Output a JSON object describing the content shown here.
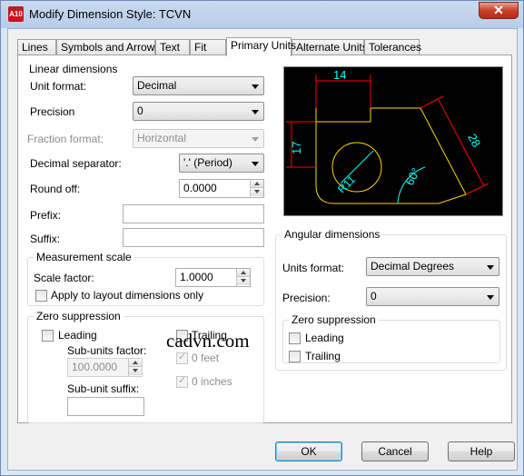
{
  "window": {
    "title": "Modify Dimension Style: TCVN",
    "app_icon_text": "A10",
    "close_symbol": "✕"
  },
  "tabs": [
    {
      "label": "Lines"
    },
    {
      "label": "Symbols and Arrows"
    },
    {
      "label": "Text"
    },
    {
      "label": "Fit"
    },
    {
      "label": "Primary Units",
      "active": true
    },
    {
      "label": "Alternate Units"
    },
    {
      "label": "Tolerances"
    }
  ],
  "linear": {
    "title": "Linear dimensions",
    "unit_format_label": "Unit format:",
    "unit_format_value": "Decimal",
    "precision_label": "Precision",
    "precision_value": "0",
    "fraction_format_label": "Fraction format:",
    "fraction_format_value": "Horizontal",
    "decimal_separator_label": "Decimal separator:",
    "decimal_separator_value": "'.' (Period)",
    "round_off_label": "Round off:",
    "round_off_value": "0.0000",
    "prefix_label": "Prefix:",
    "prefix_value": "",
    "suffix_label": "Suffix:",
    "suffix_value": ""
  },
  "measurement": {
    "title": "Measurement scale",
    "scale_factor_label": "Scale factor:",
    "scale_factor_value": "1.0000",
    "apply_layout_label": "Apply to layout dimensions only",
    "apply_layout_checked": false
  },
  "zero_linear": {
    "title": "Zero suppression",
    "leading_label": "Leading",
    "leading_checked": false,
    "trailing_label": "Trailing",
    "trailing_checked": false,
    "sub_units_factor_label": "Sub-units factor:",
    "sub_units_factor_value": "100.0000",
    "sub_unit_suffix_label": "Sub-unit suffix:",
    "sub_unit_suffix_value": "",
    "feet_label": "0 feet",
    "feet_checked": true,
    "inches_label": "0 inches",
    "inches_checked": true
  },
  "preview": {
    "dim_top": "14",
    "dim_left": "17",
    "dim_right": "28",
    "dim_angle": "60°",
    "dim_radius": "R11",
    "colors": {
      "line": "#ff0000",
      "geometry": "#ffd700",
      "text": "#00ffff",
      "background": "#000000"
    }
  },
  "angular": {
    "title": "Angular dimensions",
    "units_format_label": "Units format:",
    "units_format_value": "Decimal Degrees",
    "precision_label": "Precision:",
    "precision_value": "0",
    "zero_title": "Zero suppression",
    "leading_label": "Leading",
    "leading_checked": false,
    "trailing_label": "Trailing",
    "trailing_checked": false
  },
  "watermark": "cadvn.com",
  "buttons": {
    "ok": "OK",
    "cancel": "Cancel",
    "help": "Help"
  }
}
